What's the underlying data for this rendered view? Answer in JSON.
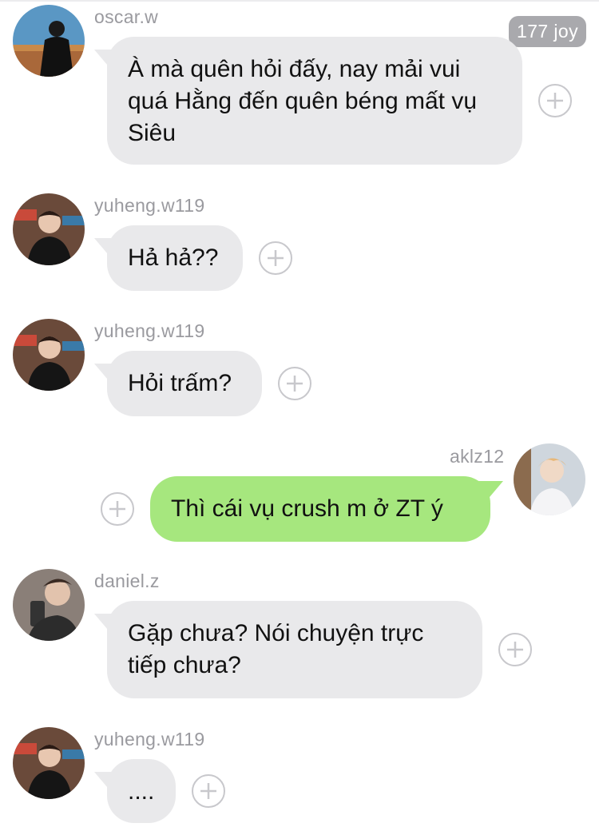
{
  "badge": {
    "text": "177 joy"
  },
  "messages": [
    {
      "user": "oscar.w",
      "text": "À mà quên hỏi đấy, nay mải vui quá Hằng đến quên béng mất vụ Siêu",
      "direction": "incoming"
    },
    {
      "user": "yuheng.w119",
      "text": "Hả hả??",
      "direction": "incoming"
    },
    {
      "user": "yuheng.w119",
      "text": "Hỏi trấm?",
      "direction": "incoming"
    },
    {
      "user": "aklz12",
      "text": "Thì cái vụ crush m ở ZT ý",
      "direction": "outgoing"
    },
    {
      "user": "daniel.z",
      "text": "Gặp chưa? Nói chuyện trực tiếp chưa?",
      "direction": "incoming"
    },
    {
      "user": "yuheng.w119",
      "text": "....",
      "direction": "incoming"
    }
  ],
  "colors": {
    "incoming_bubble": "#e9e9eb",
    "outgoing_bubble": "#a6e77e",
    "username": "#9a9a9f",
    "badge": "#a9a9ad"
  },
  "icons": {
    "react": "plus-circle-icon",
    "avatar": "user-avatar"
  }
}
